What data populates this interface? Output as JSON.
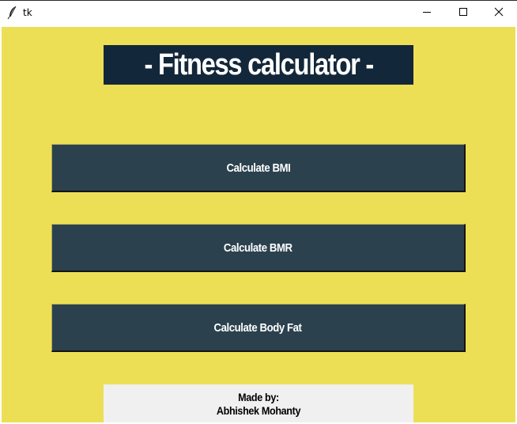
{
  "window": {
    "title": "tk"
  },
  "header": {
    "title": "- Fitness calculator -"
  },
  "buttons": {
    "bmi": "Calculate BMI",
    "bmr": "Calculate BMR",
    "body_fat": "Calculate Body Fat"
  },
  "footer": {
    "line1": "Made by:",
    "line2": "Abhishek Mohanty"
  },
  "colors": {
    "background": "#ecdf55",
    "header_bg": "#13273a",
    "button_bg": "#2b414e",
    "footer_bg": "#f0f0f0"
  },
  "icons": {
    "app": "feather-icon",
    "minimize": "minimize-icon",
    "maximize": "maximize-icon",
    "close": "close-icon"
  }
}
